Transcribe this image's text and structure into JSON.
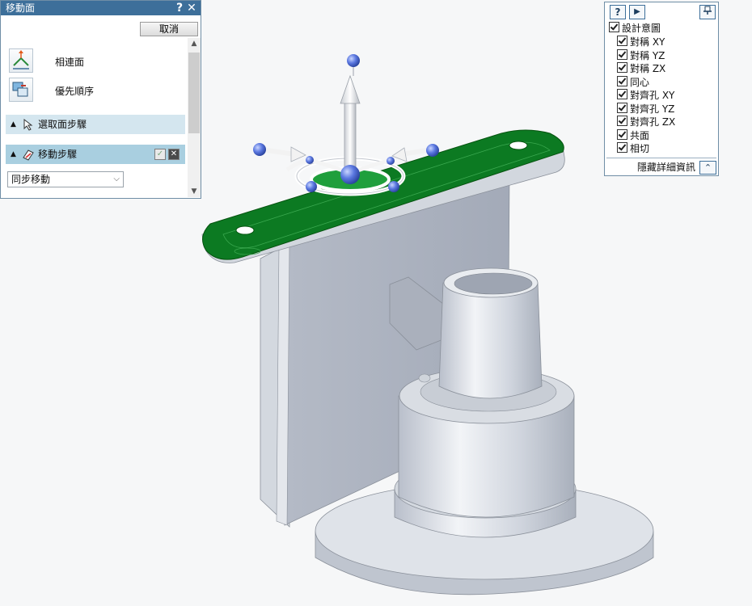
{
  "move_panel": {
    "title": "移動面",
    "help_label": "?",
    "close_label": "✕",
    "cancel_label": "取消",
    "options": [
      {
        "label": "相連面",
        "icon": "connected-faces-icon"
      },
      {
        "label": "優先順序",
        "icon": "priority-order-icon"
      }
    ],
    "steps": [
      {
        "label": "選取面步驟",
        "icon": "select-face-step-icon"
      },
      {
        "label": "移動步驟",
        "icon": "move-step-icon"
      }
    ],
    "mode_value": "同步移動"
  },
  "relations_panel": {
    "items": [
      {
        "label": "設計意圖",
        "checked": true
      },
      {
        "label": "對稱 XY",
        "checked": true
      },
      {
        "label": "對稱 YZ",
        "checked": true
      },
      {
        "label": "對稱 ZX",
        "checked": true
      },
      {
        "label": "同心",
        "checked": true
      },
      {
        "label": "對齊孔 XY",
        "checked": true
      },
      {
        "label": "對齊孔 YZ",
        "checked": true
      },
      {
        "label": "對齊孔 ZX",
        "checked": true
      },
      {
        "label": "共面",
        "checked": true
      },
      {
        "label": "相切",
        "checked": true
      }
    ],
    "hide_details_label": "隱藏詳細資訊",
    "help_label": "?",
    "play_label": "▶"
  },
  "colors": {
    "title_bar": "#3d6f9a",
    "selected_face": "#0c7a22",
    "part_body": "#c9cfd8",
    "handle": "#5b78e0"
  }
}
